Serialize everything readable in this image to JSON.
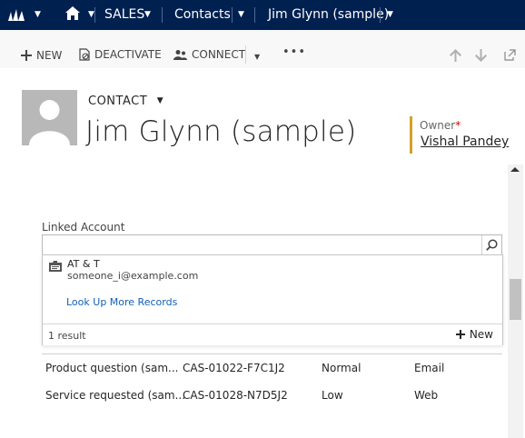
{
  "nav": {
    "app": "SALES",
    "area": "Contacts",
    "record": "Jim Glynn (sample)"
  },
  "commands": {
    "new": "NEW",
    "deactivate": "DEACTIVATE",
    "connect": "CONNECT",
    "more": "•••"
  },
  "header": {
    "entity_type": "CONTACT",
    "title": "Jim Glynn (sample)",
    "owner_label": "Owner",
    "owner_required": "*",
    "owner_value": "Vishal Pandey"
  },
  "linked_account": {
    "label": "Linked Account",
    "value": "",
    "results": [
      {
        "name": "AT & T",
        "email": "someone_i@example.com"
      }
    ],
    "lookup_more": "Look Up More Records",
    "count": "1 result",
    "new_label": "New"
  },
  "cases": {
    "rows": [
      {
        "title": "Product question (sam...",
        "number": "CAS-01022-F7C1J2",
        "priority": "Normal",
        "origin": "Email"
      },
      {
        "title": "Service requested (sam...",
        "number": "CAS-01028-N7D5J2",
        "priority": "Low",
        "origin": "Web"
      }
    ]
  },
  "colors": {
    "navbar": "#002050",
    "owner_accent": "#d6a02a",
    "link": "#1160b7"
  }
}
